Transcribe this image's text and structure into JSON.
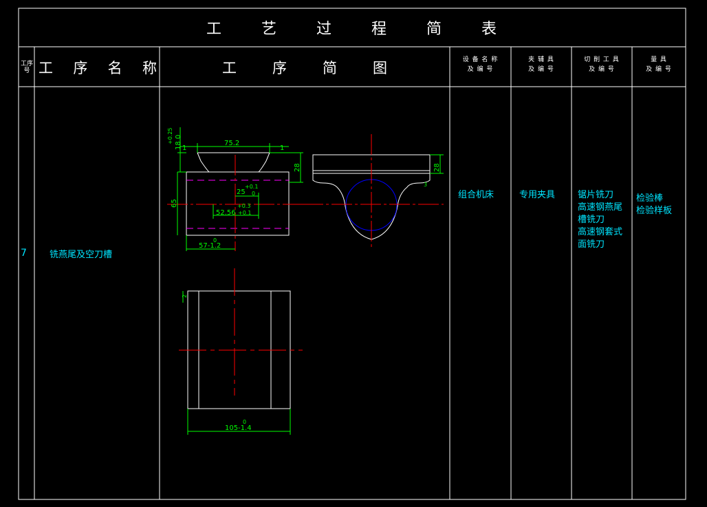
{
  "header": {
    "title_chars": [
      "工",
      "艺",
      "过",
      "程",
      "简",
      "表"
    ],
    "col_no": "工序号",
    "col_name_chars": [
      "工",
      "序",
      "名",
      "称"
    ],
    "col_sketch_chars": [
      "工",
      "序",
      "简",
      "图"
    ],
    "col_equipment": [
      "设 备 名 称",
      "及 编 号"
    ],
    "col_fixture": [
      "夹 辅 具",
      "及 编 号"
    ],
    "col_tools": [
      "切 削 工 具",
      "及 编 号"
    ],
    "col_gauges": [
      "量   具",
      "及 编 号"
    ]
  },
  "row": {
    "no": "7",
    "name": "铣燕尾及空刀槽",
    "equipment": "组合机床",
    "fixture": "专用夹具",
    "tools": [
      "锯片铣刀",
      "高速钢燕尾",
      "槽铣刀",
      "高速钢套式",
      "面铣刀"
    ],
    "gauges": [
      "检验棒",
      "检验样板"
    ]
  },
  "dimensions": {
    "top_width": "75.2",
    "left_gap": "1",
    "right_gap": "1",
    "vertical_tol": "+0.25",
    "vertical_nom": "18 0",
    "depth_right": "28",
    "slot_width": "25",
    "slot_tol_upper": "+0.1",
    "slot_tol_lower": "0",
    "center_tol": "+0.3",
    "center_dist": "52.56",
    "center_tol_lower": "+0.1",
    "height_left": "65",
    "bottom_tol": "0",
    "bottom_len": "57-1.2",
    "side_height": "28",
    "side_small": "3",
    "plan_tol": "0",
    "plan_len": "105-1.4",
    "plan_mark": "2"
  },
  "colors": {
    "border": "#ffffff",
    "dimension": "#00ff00",
    "centerline": "#ff0000",
    "text": "#00e5ff",
    "hidden": "#ff00ff",
    "circle": "#0000ff"
  }
}
